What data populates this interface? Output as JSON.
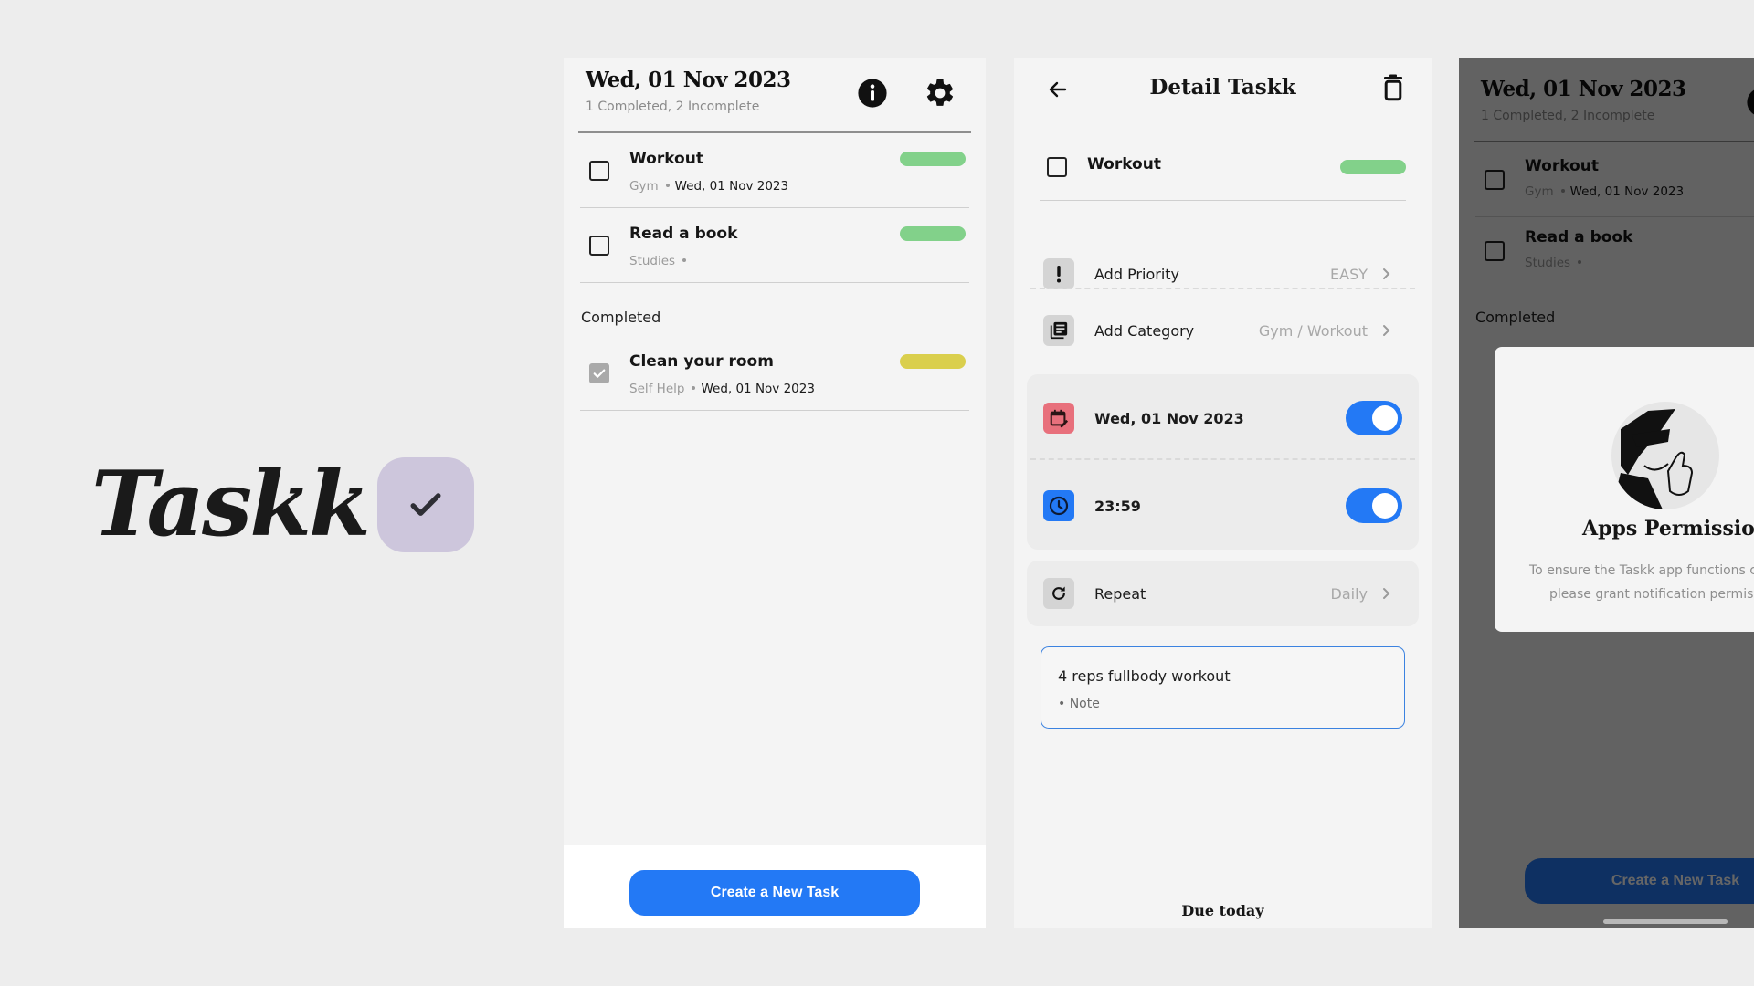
{
  "brand": {
    "name": "Taskk",
    "badge_icon": "check-icon",
    "badge_color": "#cdc6dc"
  },
  "colors": {
    "accent": "#2379f5",
    "priority_easy": "#82d18a",
    "priority_medium": "#dacf4d",
    "calendar_icon_bg": "#e8707c",
    "clock_icon_bg": "#2379f5",
    "neutral_icon_bg": "#d4d4d4"
  },
  "home": {
    "date_title": "Wed, 01 Nov 2023",
    "summary": "1 Completed, 2 Incomplete",
    "info_icon": "info-icon",
    "settings_icon": "gear-icon",
    "incomplete_tasks": [
      {
        "title": "Workout",
        "category": "Gym",
        "date": "Wed, 01 Nov 2023",
        "priority_color": "#82d18a",
        "done": false
      },
      {
        "title": "Read a book",
        "category": "Studies",
        "date": "",
        "priority_color": "#82d18a",
        "done": false
      }
    ],
    "completed_label": "Completed",
    "completed_tasks": [
      {
        "title": "Clean your room",
        "category": "Self Help",
        "date": "Wed, 01 Nov 2023",
        "priority_color": "#dacf4d",
        "done": true
      }
    ],
    "create_button": "Create a New Task"
  },
  "detail": {
    "title": "Detail Taskk",
    "back_icon": "arrow-left-icon",
    "delete_icon": "trash-icon",
    "task_title": "Workout",
    "task_priority_color": "#82d18a",
    "priority": {
      "label": "Add Priority",
      "value": "EASY"
    },
    "category": {
      "label": "Add Category",
      "value": "Gym / Workout"
    },
    "date": {
      "label": "Wed, 01 Nov 2023",
      "enabled": true
    },
    "time": {
      "label": "23:59",
      "enabled": true
    },
    "repeat": {
      "label": "Repeat",
      "value": "Daily"
    },
    "note": {
      "text": "4 reps fullbody workout",
      "hint": "• Note"
    },
    "due_label": "Due today"
  },
  "permission_screen": {
    "date_title": "Wed, 01 Nov 2023",
    "summary": "1 Completed, 2 Incomplete",
    "tasks": [
      {
        "title": "Workout",
        "category": "Gym",
        "date": "Wed, 01 Nov 2023"
      },
      {
        "title": "Read a book",
        "category": "Studies",
        "date": ""
      }
    ],
    "completed_label": "Completed",
    "create_button": "Create a New Task",
    "dialog": {
      "title": "Apps Permission",
      "body_line1": "To ensure the Taskk app functions correctly,",
      "body_line2": "please grant notification permission."
    }
  }
}
